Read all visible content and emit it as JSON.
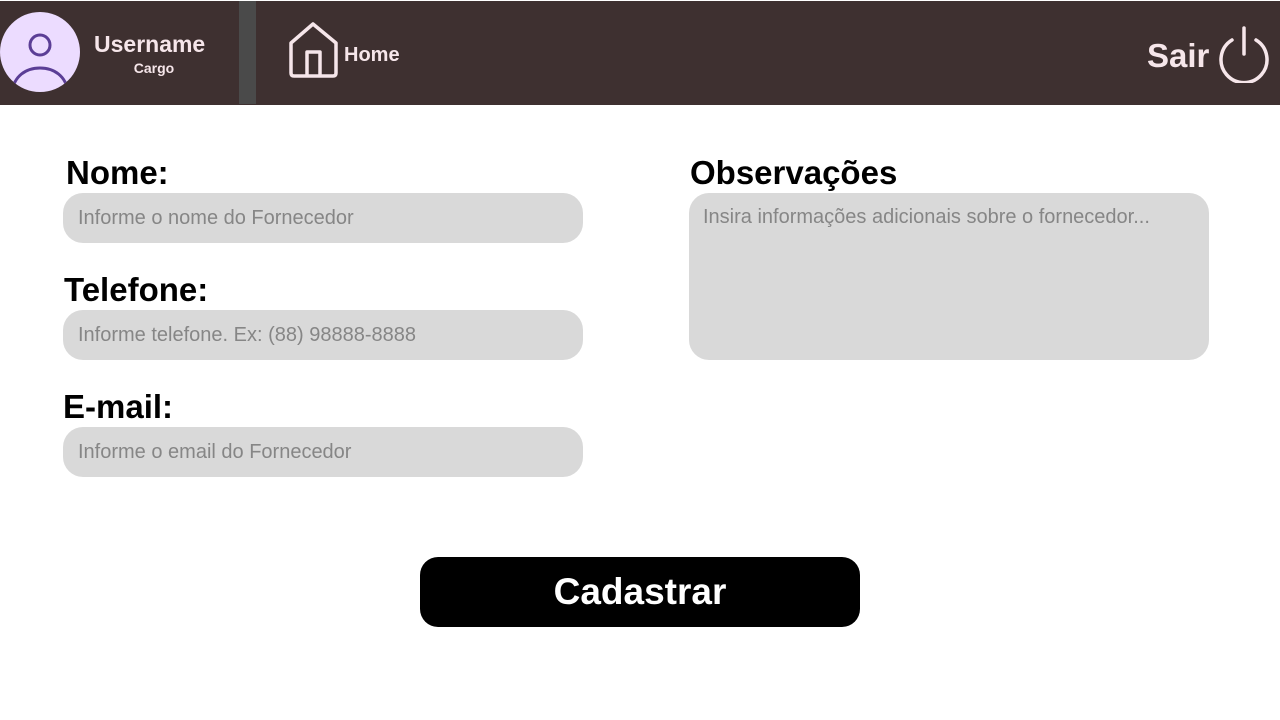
{
  "header": {
    "user": {
      "name": "Username",
      "role": "Cargo"
    },
    "nav": {
      "home_label": "Home"
    },
    "logout_label": "Sair"
  },
  "form": {
    "nome": {
      "label": "Nome:",
      "value": "",
      "placeholder": "Informe o nome do Fornecedor"
    },
    "telefone": {
      "label": "Telefone:",
      "value": "",
      "placeholder": "Informe telefone. Ex: (88) 98888-8888"
    },
    "email": {
      "label": "E-mail:",
      "value": "",
      "placeholder": "Informe o email do Fornecedor"
    },
    "observacoes": {
      "label": "Observações",
      "value": "",
      "placeholder": "Insira informações adicionais sobre o fornecedor..."
    },
    "submit_label": "Cadastrar"
  },
  "colors": {
    "header_bg": "#3e3030",
    "header_text": "#f6e6ea",
    "avatar_bg": "#ecdcff",
    "avatar_icon": "#5b3e96",
    "input_bg": "#d9d9d9",
    "button_bg": "#000000"
  },
  "icons": {
    "avatar": "user-avatar-icon",
    "home": "home-icon",
    "logout": "power-icon"
  }
}
